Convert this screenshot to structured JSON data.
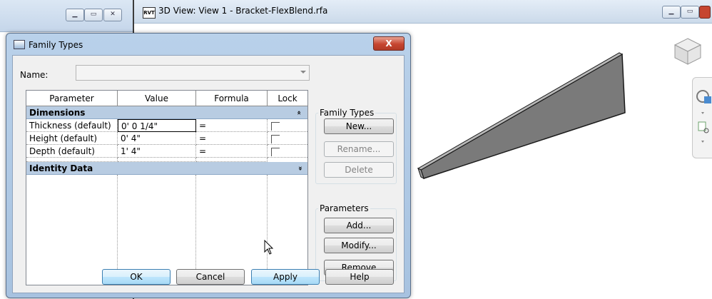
{
  "view_window": {
    "title": "3D View: View 1 - Bracket-FlexBlend.rfa",
    "icon_text": "RVT",
    "icon": "revit-file-icon"
  },
  "left_window_buttons": [
    "minimize-icon",
    "restore-icon",
    "close-icon"
  ],
  "right_window_buttons": [
    "minimize-icon",
    "restore-icon",
    "close-icon"
  ],
  "dialog": {
    "title": "Family Types",
    "close_label": "X",
    "name_label": "Name:",
    "name_value": "",
    "columns": [
      "Parameter",
      "Value",
      "Formula",
      "Lock"
    ],
    "groups": [
      {
        "label": "Dimensions",
        "state": "expanded",
        "chevron": "»"
      },
      {
        "label": "Identity Data",
        "state": "collapsed",
        "chevron": "»"
      }
    ],
    "rows": [
      {
        "parameter": "Thickness (default)",
        "value": "0'  0 1/4\"",
        "formula": "=",
        "lock": false
      },
      {
        "parameter": "Height (default)",
        "value": "0'  4\"",
        "formula": "=",
        "lock": false
      },
      {
        "parameter": "Depth (default)",
        "value": "1'  4\"",
        "formula": "=",
        "lock": false
      }
    ],
    "family_types_group": {
      "label": "Family Types",
      "new": "New...",
      "rename": "Rename...",
      "delete": "Delete"
    },
    "parameters_group": {
      "label": "Parameters",
      "add": "Add...",
      "modify": "Modify...",
      "remove": "Remove"
    },
    "footer": {
      "ok": "OK",
      "cancel": "Cancel",
      "apply": "Apply",
      "help": "Help"
    }
  },
  "colors": {
    "group_header": "#b8cce2",
    "dialog_frame": "#a7c2e0",
    "close_button": "#c64530",
    "model_face": "#7a7a7a"
  }
}
